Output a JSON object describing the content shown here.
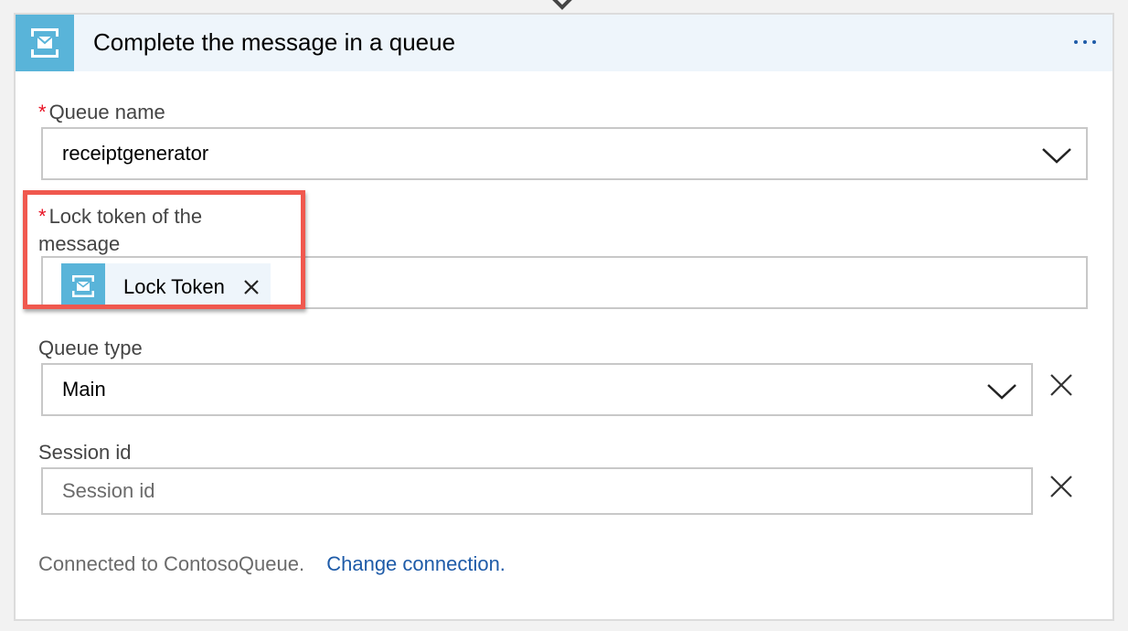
{
  "card": {
    "title": "Complete the message in a queue",
    "icon": "service-bus-queue-icon",
    "accent_color": "#59b4d9",
    "header_bg": "#eef5fb"
  },
  "fields": {
    "queue_name": {
      "label": "Queue name",
      "required": true,
      "value": "receiptgenerator"
    },
    "lock_token": {
      "label_line1": "Lock token of the",
      "label_line2": "message",
      "required": true,
      "token": {
        "label": "Lock Token",
        "icon": "service-bus-queue-icon"
      }
    },
    "queue_type": {
      "label": "Queue type",
      "value": "Main"
    },
    "session_id": {
      "label": "Session id",
      "placeholder": "Session id"
    }
  },
  "footer": {
    "status": "Connected to ContosoQueue.",
    "change_link": "Change connection."
  },
  "colors": {
    "required": "#e81123",
    "highlight": "#f0584e",
    "link": "#1e5ba8"
  }
}
